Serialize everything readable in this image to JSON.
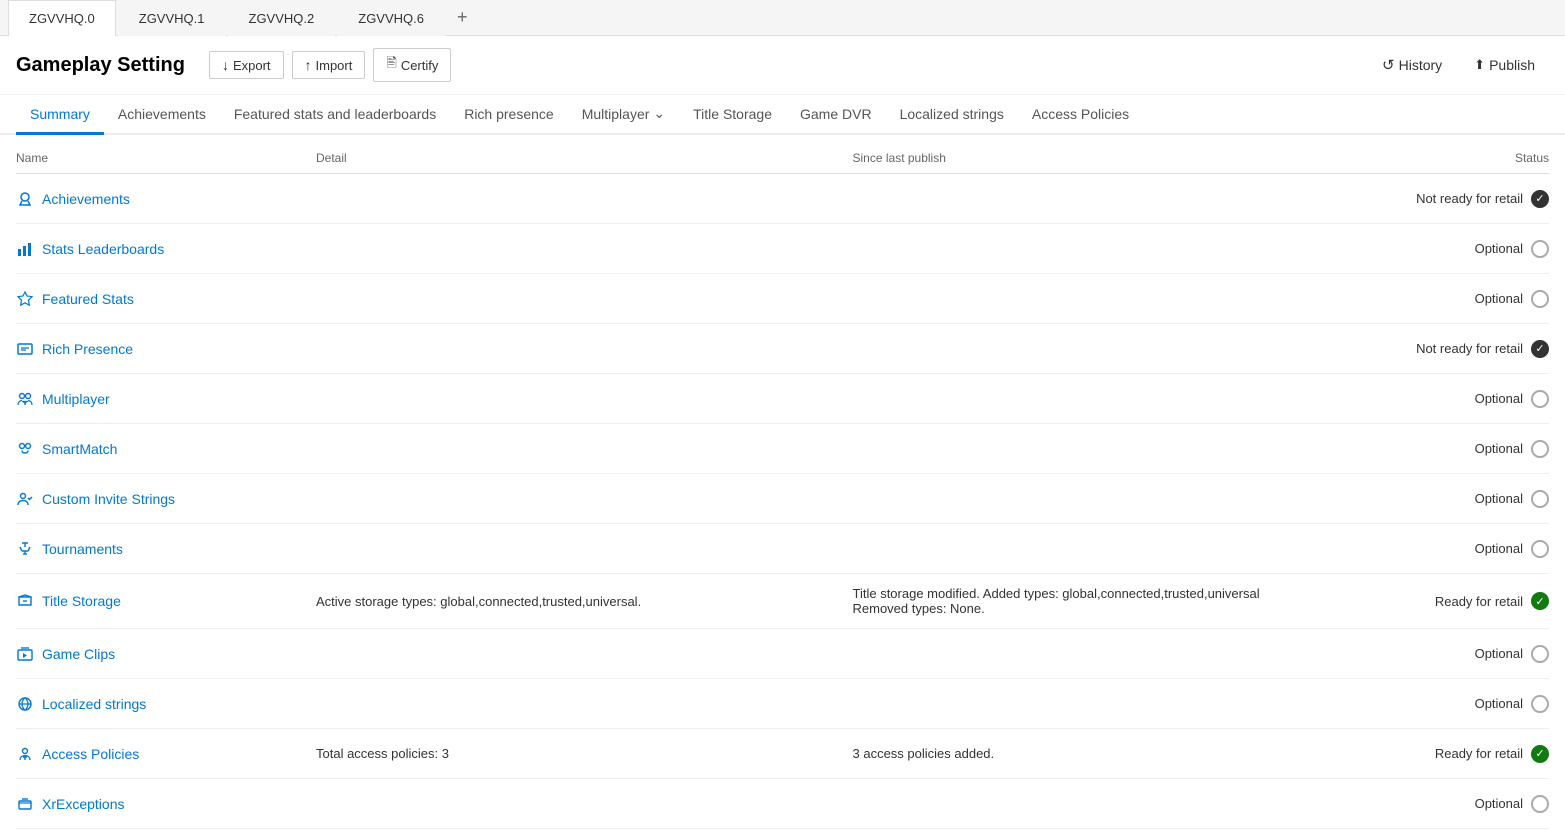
{
  "tabs": [
    {
      "id": "tab-0",
      "label": "ZGVVHQ.0",
      "active": true
    },
    {
      "id": "tab-1",
      "label": "ZGVVHQ.1",
      "active": false
    },
    {
      "id": "tab-2",
      "label": "ZGVVHQ.2",
      "active": false
    },
    {
      "id": "tab-3",
      "label": "ZGVVHQ.6",
      "active": false
    }
  ],
  "tab_add": "+",
  "header": {
    "title": "Gameplay Setting",
    "export_label": "Export",
    "import_label": "Import",
    "certify_label": "Certify",
    "history_label": "History",
    "publish_label": "Publish"
  },
  "nav_tabs": [
    {
      "id": "summary",
      "label": "Summary",
      "active": true
    },
    {
      "id": "achievements",
      "label": "Achievements",
      "active": false
    },
    {
      "id": "featured-stats",
      "label": "Featured stats and leaderboards",
      "active": false
    },
    {
      "id": "rich-presence",
      "label": "Rich presence",
      "active": false
    },
    {
      "id": "multiplayer",
      "label": "Multiplayer",
      "active": false,
      "has_arrow": true
    },
    {
      "id": "title-storage",
      "label": "Title Storage",
      "active": false
    },
    {
      "id": "game-dvr",
      "label": "Game DVR",
      "active": false
    },
    {
      "id": "localized-strings",
      "label": "Localized strings",
      "active": false
    },
    {
      "id": "access-policies",
      "label": "Access Policies",
      "active": false
    }
  ],
  "table": {
    "columns": [
      "Name",
      "Detail",
      "Since last publish",
      "Status"
    ],
    "rows": [
      {
        "id": "achievements",
        "name": "Achievements",
        "icon": "achievements",
        "detail": "",
        "since": "",
        "status_text": "Not ready for retail",
        "status_type": "not-ready"
      },
      {
        "id": "stats-leaderboards",
        "name": "Stats Leaderboards",
        "icon": "stats",
        "detail": "",
        "since": "",
        "status_text": "Optional",
        "status_type": "circle"
      },
      {
        "id": "featured-stats",
        "name": "Featured Stats",
        "icon": "featured",
        "detail": "",
        "since": "",
        "status_text": "Optional",
        "status_type": "circle"
      },
      {
        "id": "rich-presence",
        "name": "Rich Presence",
        "icon": "rich-presence",
        "detail": "",
        "since": "",
        "status_text": "Not ready for retail",
        "status_type": "not-ready"
      },
      {
        "id": "multiplayer",
        "name": "Multiplayer",
        "icon": "multiplayer",
        "detail": "",
        "since": "",
        "status_text": "Optional",
        "status_type": "circle"
      },
      {
        "id": "smartmatch",
        "name": "SmartMatch",
        "icon": "smartmatch",
        "detail": "",
        "since": "",
        "status_text": "Optional",
        "status_type": "circle"
      },
      {
        "id": "custom-invite",
        "name": "Custom Invite Strings",
        "icon": "invite",
        "detail": "",
        "since": "",
        "status_text": "Optional",
        "status_type": "circle"
      },
      {
        "id": "tournaments",
        "name": "Tournaments",
        "icon": "tournaments",
        "detail": "",
        "since": "",
        "status_text": "Optional",
        "status_type": "circle"
      },
      {
        "id": "title-storage",
        "name": "Title Storage",
        "icon": "title-storage",
        "detail": "Active storage types: global,connected,trusted,universal.",
        "since": "Title storage modified. Added types: global,connected,trusted,universal\nRemoved types: None.",
        "status_text": "Ready for retail",
        "status_type": "ready"
      },
      {
        "id": "game-clips",
        "name": "Game Clips",
        "icon": "game-clips",
        "detail": "",
        "since": "",
        "status_text": "Optional",
        "status_type": "circle"
      },
      {
        "id": "localized-strings",
        "name": "Localized strings",
        "icon": "localized",
        "detail": "",
        "since": "",
        "status_text": "Optional",
        "status_type": "circle"
      },
      {
        "id": "access-policies",
        "name": "Access Policies",
        "icon": "access",
        "detail": "Total access policies: 3",
        "since": "3 access policies added.",
        "status_text": "Ready for retail",
        "status_type": "ready"
      },
      {
        "id": "xr-exceptions",
        "name": "XrExceptions",
        "icon": "xr",
        "detail": "",
        "since": "",
        "status_text": "Optional",
        "status_type": "circle"
      }
    ]
  },
  "icons": {
    "export": "↓",
    "import": "↑",
    "certify": "□",
    "history": "↺",
    "publish": "⬆"
  }
}
